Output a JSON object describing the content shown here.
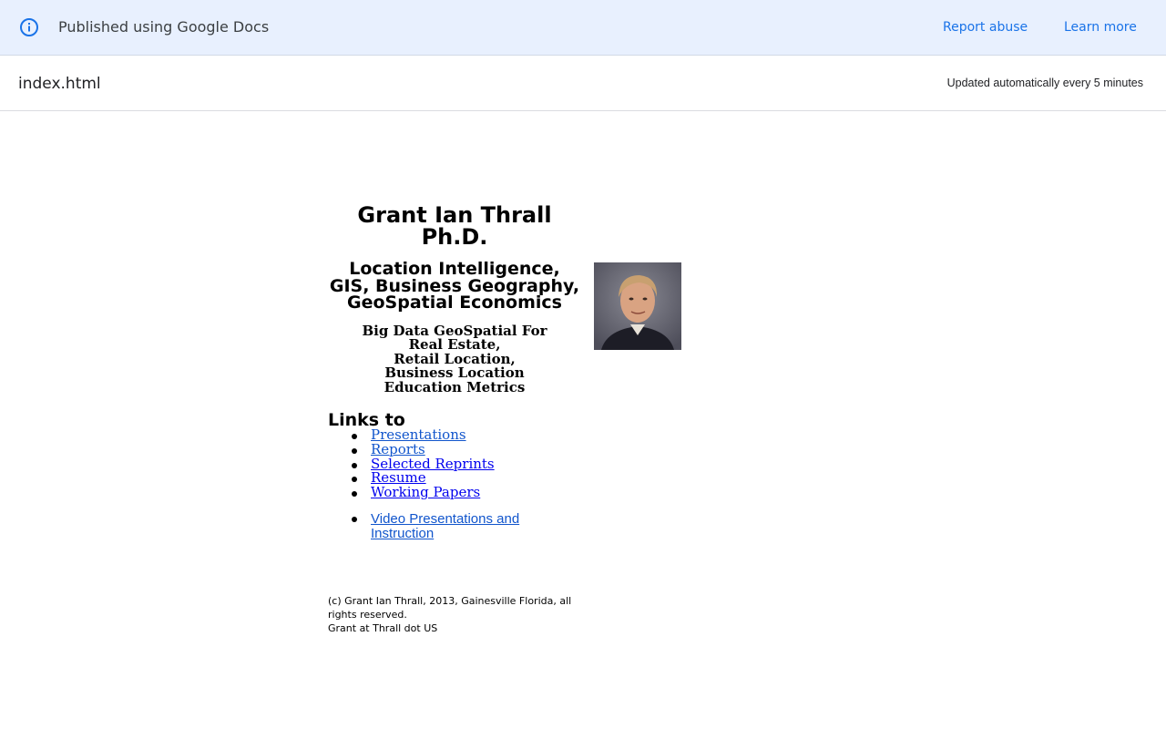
{
  "banner": {
    "text": "Published using Google Docs",
    "report_abuse": "Report abuse",
    "learn_more": "Learn more",
    "icon": "info-icon",
    "background": "#e8f0fe",
    "link_color": "#1a73e8"
  },
  "titlebar": {
    "doc_name": "index.html",
    "updated": "Updated automatically every 5 minutes"
  },
  "doc": {
    "name_line1": "Grant Ian Thrall",
    "name_line2": "Ph.D.",
    "subtitle_lines": [
      "Location Intelligence,",
      "GIS, Business Geography,",
      "GeoSpatial Economics"
    ],
    "focus_lines": [
      "Big Data GeoSpatial For",
      "Real Estate,",
      "Retail Location,",
      "Business Location",
      "Education Metrics"
    ],
    "photo": "portrait-photo",
    "links_title": "Links to",
    "links": [
      {
        "label": "Presentations"
      },
      {
        "label": "Reports"
      },
      {
        "label": "Selected Reprints"
      },
      {
        "label": "Resume"
      },
      {
        "label": "Working Papers"
      }
    ],
    "video_link": "Video Presentations and Instruction",
    "footer_line1": "(c) Grant Ian Thrall, 2013, Gainesville Florida, all rights reserved.",
    "footer_line2": "Grant at Thrall dot US"
  }
}
